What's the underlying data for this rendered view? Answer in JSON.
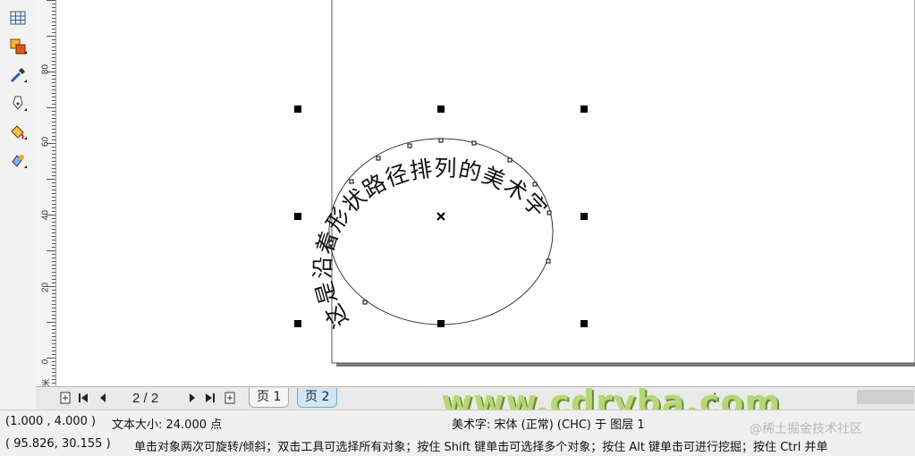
{
  "toolbox": {
    "tools": [
      {
        "name": "table-tool-icon"
      },
      {
        "name": "interactive-fill-tool-icon"
      },
      {
        "name": "eyedropper-tool-icon"
      },
      {
        "name": "outline-pen-tool-icon"
      },
      {
        "name": "fill-bucket-tool-icon"
      },
      {
        "name": "interactive-fill-tool-2-icon"
      }
    ]
  },
  "ruler": {
    "labels": [
      "80",
      "60",
      "40",
      "20",
      "0"
    ],
    "unit": "毫米"
  },
  "canvas": {
    "path_text": "这是沿着形状路径排列的美术字"
  },
  "page_nav": {
    "page_count": "2 / 2",
    "tabs": [
      "页 1",
      "页 2"
    ],
    "watermark": "www.cdryba.com"
  },
  "status": {
    "coords_top": "(1.000 , 4.000 )",
    "text_size": "文本大小: 24.000 点",
    "object_info": "美术字: 宋体 (正常) (CHC) 于 图层 1",
    "coords_bottom": "( 95.826, 30.155 )",
    "hint": "单击对象两次可旋转/倾斜；双击工具可选择所有对象；按住 Shift 键单击可选择多个对象；按住 Alt 键单击可进行挖掘；按住 Ctrl 并单",
    "watermark": "@稀土掘金技术社区"
  }
}
